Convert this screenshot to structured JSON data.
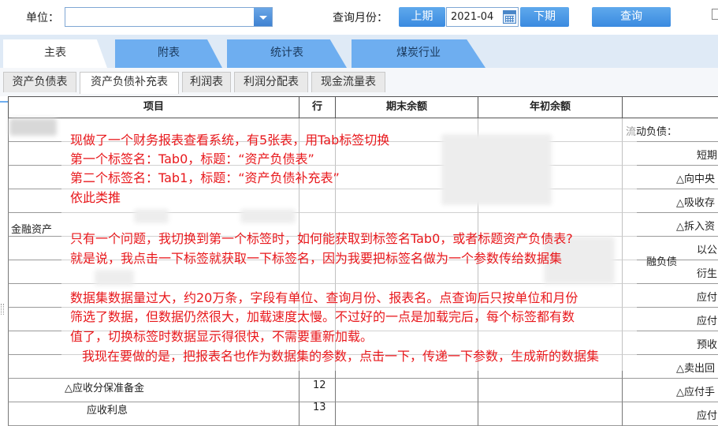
{
  "toolbar": {
    "unit_label": "单位：",
    "unit_value": "",
    "month_label": "查询月份：",
    "prev_label": "上期",
    "month_value": "2021-04",
    "next_label": "下期",
    "query_label": "查询"
  },
  "main_tabs": [
    "主表",
    "附表",
    "统计表",
    "煤炭行业"
  ],
  "sub_tabs": [
    "资产负债表",
    "资产负债补充表",
    "利润表",
    "利润分配表",
    "现金流量表"
  ],
  "table": {
    "headers": [
      "项目",
      "行",
      "期末余额",
      "年初余额",
      ""
    ],
    "left_labels": [
      "金融资产",
      "△应收分保准备金",
      "应收利息"
    ],
    "row_numbers": [
      "12",
      "13"
    ],
    "right_labels": [
      "流动负债：",
      "短期",
      "△向中央",
      "△吸收存",
      "△拆入资",
      "以公",
      "衍生",
      "应付",
      "应付",
      "预收",
      "△卖出回",
      "△应付手",
      "应付"
    ],
    "mid_label": "融负债"
  },
  "note": {
    "line1": "现做了一个财务报表查看系统，有5张表，用Tab标签切换",
    "line2": "第一个标签名：Tab0，标题：“资产负债表”",
    "line3": "第二个标签名：Tab1，标题：“资产负债补充表”",
    "line4": "依此类推",
    "line5": "只有一个问题，我切换到第一个标签时，如何能获取到标签名Tab0，或者标题资产负债表?",
    "line6": "就是说，我点击一下标签就获取一下标签名，因为我要把标签名做为一个参数传给数据集",
    "line7": "数据集数据量过大，约20万条，字段有单位、查询月份、报表名。点查询后只按单位和月份",
    "line8": "筛选了数据，但数据仍然很大，加载速度太慢。不过好的一点是加载完后，每个标签都有数",
    "line9": "值了，切换标签时数据显示得很快，不需要重新加载。",
    "line10": "我现在要做的是，把报表名也作为数据集的参数，点击一下，传递一下参数，生成新的数据集"
  },
  "colors": {
    "accent_blue": "#3a8ae0",
    "tab_blue": "#6eaef0",
    "note_red": "#e8181c"
  }
}
